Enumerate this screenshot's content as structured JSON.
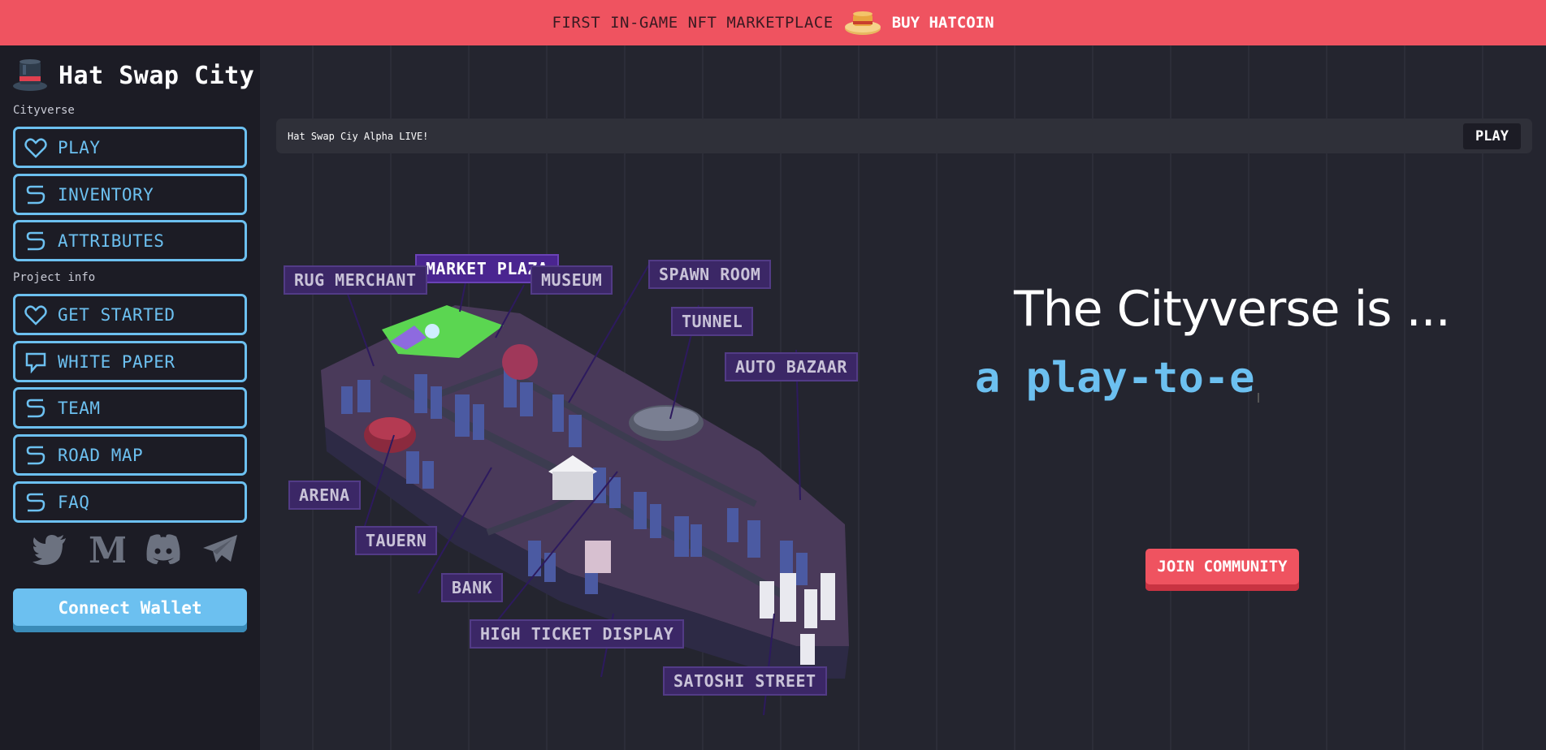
{
  "banner": {
    "text": "FIRST IN-GAME NFT MARKETPLACE",
    "link": "BUY HATCOIN",
    "coin_icon": "hat-coin-icon",
    "background": "#ef5360"
  },
  "sidebar": {
    "brand": {
      "title": "Hat Swap City",
      "icon": "top-hat-icon"
    },
    "sections": [
      {
        "label": "Cityverse",
        "items": [
          {
            "label": "PLAY",
            "icon": "heart-icon"
          },
          {
            "label": "INVENTORY",
            "icon": "swirl-icon"
          },
          {
            "label": "ATTRIBUTES",
            "icon": "swirl-icon"
          }
        ]
      },
      {
        "label": "Project info",
        "items": [
          {
            "label": "GET STARTED",
            "icon": "heart-icon"
          },
          {
            "label": "WHITE PAPER",
            "icon": "chat-bubble-icon"
          },
          {
            "label": "TEAM",
            "icon": "swirl-icon"
          },
          {
            "label": "ROAD MAP",
            "icon": "swirl-icon"
          },
          {
            "label": "FAQ",
            "icon": "swirl-icon"
          }
        ]
      }
    ],
    "socials": [
      "twitter-icon",
      "medium-icon",
      "discord-icon",
      "telegram-icon"
    ],
    "connect_wallet": "Connect Wallet",
    "accent": "#6cc0f0"
  },
  "announcement": {
    "text": "Hat Swap Ciy Alpha LIVE!",
    "button": "PLAY"
  },
  "map": {
    "labels": [
      {
        "text": "MARKET PLAZA",
        "active": true
      },
      {
        "text": "RUG MERCHANT"
      },
      {
        "text": "MUSEUM"
      },
      {
        "text": "SPAWN ROOM"
      },
      {
        "text": "TUNNEL"
      },
      {
        "text": "AUTO BAZAAR"
      },
      {
        "text": "ARENA"
      },
      {
        "text": "TAUERN"
      },
      {
        "text": "BANK"
      },
      {
        "text": "HIGH TICKET DISPLAY"
      },
      {
        "text": "SATOSHI STREET"
      }
    ]
  },
  "hero": {
    "title": "The Cityverse is ...",
    "typed": "a play-to-e",
    "cta": "JOIN COMMUNITY"
  }
}
